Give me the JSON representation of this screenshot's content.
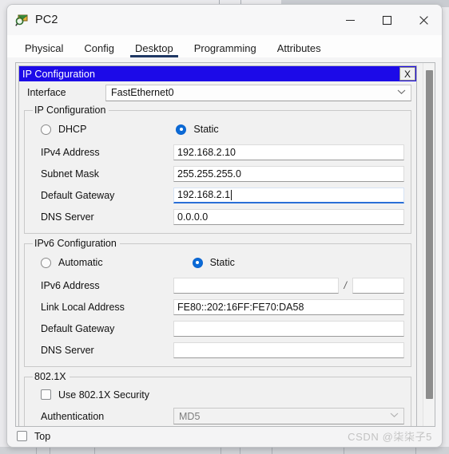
{
  "window": {
    "title": "PC2",
    "icon": "packet-tracer-device-icon",
    "controls": {
      "minimize": "─",
      "maximize": "☐",
      "close": "✕"
    }
  },
  "tabs": [
    {
      "label": "Physical",
      "active": false
    },
    {
      "label": "Config",
      "active": false
    },
    {
      "label": "Desktop",
      "active": true
    },
    {
      "label": "Programming",
      "active": false
    },
    {
      "label": "Attributes",
      "active": false
    }
  ],
  "ip_window": {
    "title": "IP Configuration",
    "close_label": "X",
    "interface": {
      "label": "Interface",
      "value": "FastEthernet0",
      "caret": "⌄"
    },
    "ipv4": {
      "legend": "IP Configuration",
      "mode": {
        "dhcp_label": "DHCP",
        "dhcp_selected": false,
        "static_label": "Static",
        "static_selected": true
      },
      "fields": [
        {
          "label": "IPv4 Address",
          "value": "192.168.2.10",
          "focused": false
        },
        {
          "label": "Subnet Mask",
          "value": "255.255.255.0",
          "focused": false
        },
        {
          "label": "Default Gateway",
          "value": "192.168.2.1",
          "focused": true
        },
        {
          "label": "DNS Server",
          "value": "0.0.0.0",
          "focused": false
        }
      ]
    },
    "ipv6": {
      "legend": "IPv6 Configuration",
      "mode": {
        "automatic_label": "Automatic",
        "automatic_selected": false,
        "static_label": "Static",
        "static_selected": true
      },
      "address_label": "IPv6 Address",
      "address_value": "",
      "prefix_separator": "/",
      "prefix_value": "",
      "fields": [
        {
          "label": "Link Local Address",
          "value": "FE80::202:16FF:FE70:DA58"
        },
        {
          "label": "Default Gateway",
          "value": ""
        },
        {
          "label": "DNS Server",
          "value": ""
        }
      ]
    },
    "dot1x": {
      "legend": "802.1X",
      "use_security_label": "Use 802.1X Security",
      "use_security_checked": false,
      "authentication_label": "Authentication",
      "authentication_value": "MD5",
      "caret": "⌄"
    }
  },
  "bottom": {
    "top_label": "Top",
    "top_checked": false,
    "watermark": "CSDN @柒柒子5"
  },
  "colors": {
    "ip_window_titlebar": "#1c0ae8",
    "selected_radio": "#0b6ad6",
    "active_tab_underline": "#1f3864",
    "focused_field_underline": "#2a6fd6"
  }
}
